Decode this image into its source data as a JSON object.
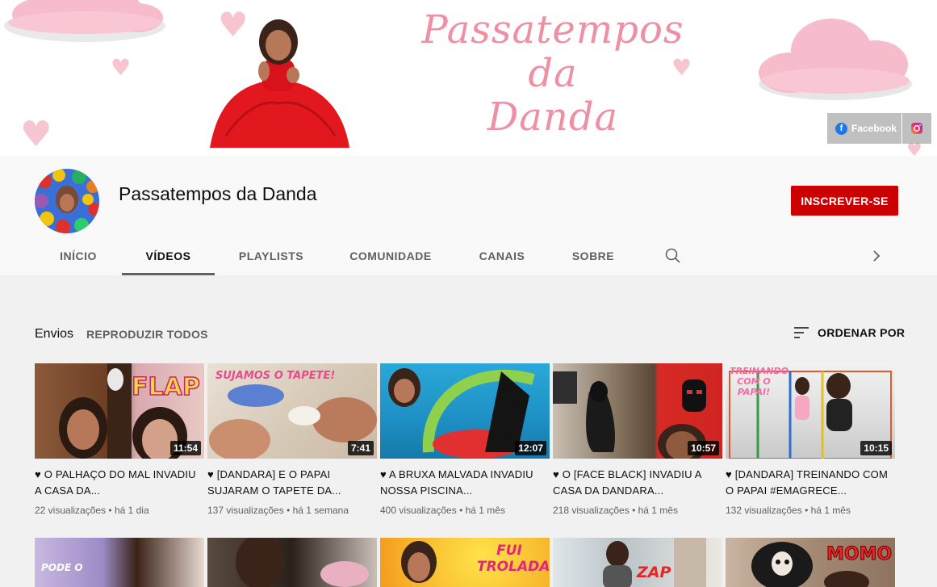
{
  "banner": {
    "title_line1": "Passatempos",
    "title_line2": "da",
    "title_line3": "Danda",
    "links": [
      {
        "label": "Facebook",
        "icon": "facebook-icon"
      },
      {
        "label": "",
        "icon": "instagram-icon"
      }
    ]
  },
  "channel": {
    "name": "Passatempos da Danda",
    "subscribe_label": "INSCREVER-SE"
  },
  "tabs": [
    {
      "label": "INÍCIO"
    },
    {
      "label": "VÍDEOS",
      "active": true
    },
    {
      "label": "PLAYLISTS"
    },
    {
      "label": "COMUNIDADE"
    },
    {
      "label": "CANAIS"
    },
    {
      "label": "SOBRE"
    }
  ],
  "section": {
    "title": "Envios",
    "play_all": "REPRODUZIR TODOS",
    "sort_label": "ORDENAR POR"
  },
  "videos": [
    {
      "title": "♥ O PALHAÇO DO MAL INVADIU A CASA DA...",
      "duration": "11:54",
      "views": "22 visualizações",
      "age": "há 1 dia",
      "thumb_text": "FLAP"
    },
    {
      "title": "♥ [DANDARA] E O PAPAI SUJARAM O TAPETE DA...",
      "duration": "7:41",
      "views": "137 visualizações",
      "age": "há 1 semana",
      "thumb_text": "SUJAMOS O TAPETE!"
    },
    {
      "title": "♥ A BRUXA MALVADA INVADIU NOSSA PISCINA...",
      "duration": "12:07",
      "views": "400 visualizações",
      "age": "há 1 mês",
      "thumb_text": ""
    },
    {
      "title": "♥ O [FACE BLACK] INVADIU A CASA DA DANDARA...",
      "duration": "10:57",
      "views": "218 visualizações",
      "age": "há 1 mês",
      "thumb_text": ""
    },
    {
      "title": "♥ [DANDARA] TREINANDO COM O PAPAI #EMAGRECE...",
      "duration": "10:15",
      "views": "132 visualizações",
      "age": "há 1 mês",
      "thumb_text": "TREINANDO COM O PAPAI!"
    }
  ],
  "videos_row2": [
    {
      "thumb_text": "PODE O"
    },
    {
      "thumb_text": ""
    },
    {
      "thumb_text": "FUI TROLADA!"
    },
    {
      "thumb_text": "ZAP"
    },
    {
      "thumb_text": "MOMO"
    }
  ],
  "separator": " • "
}
